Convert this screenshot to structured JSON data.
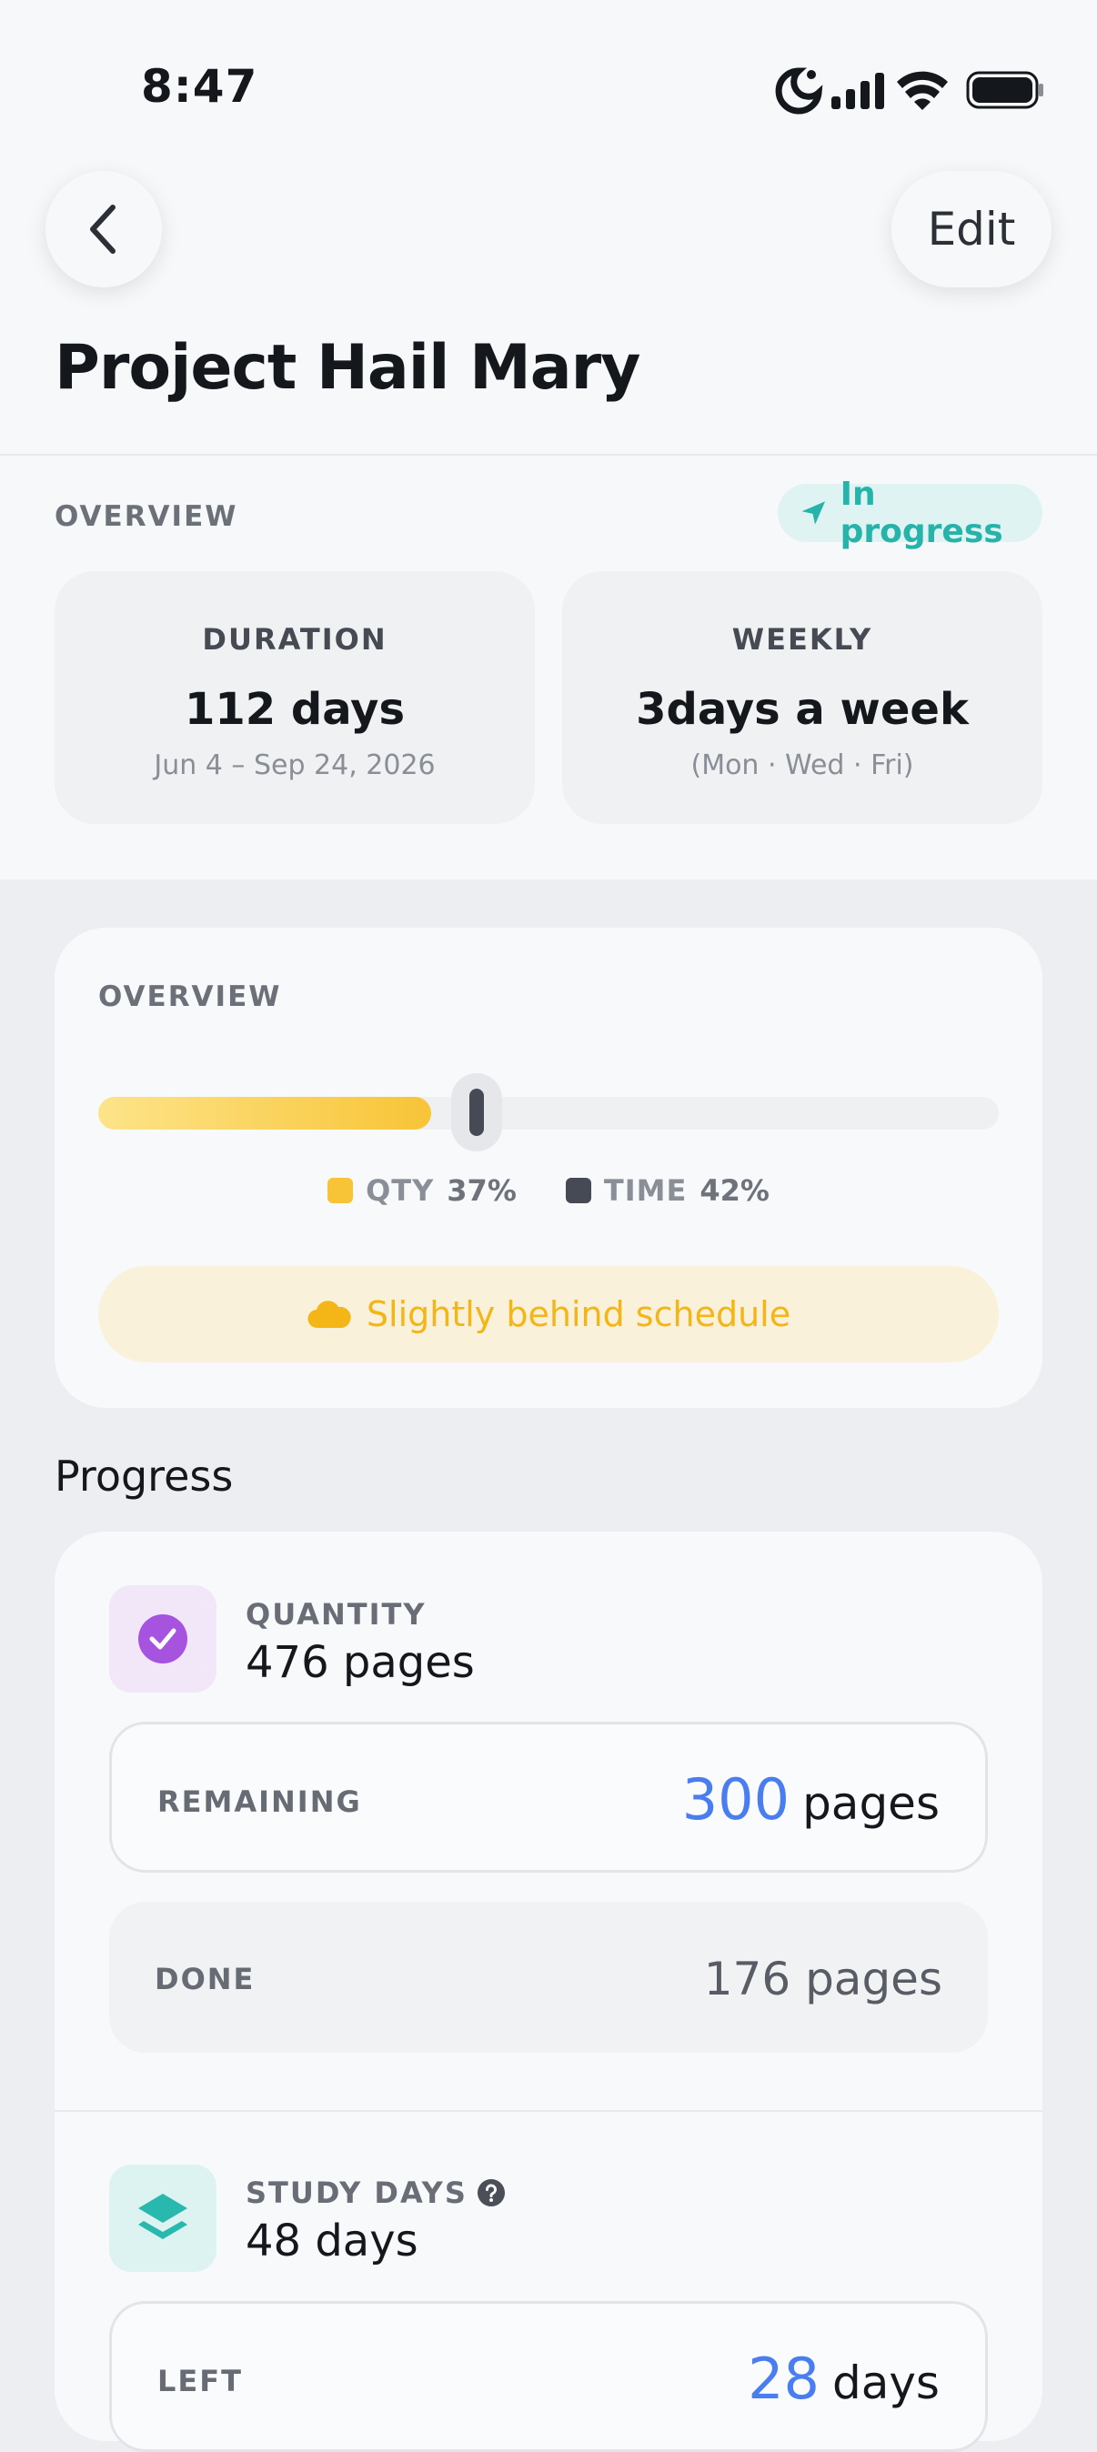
{
  "status_bar": {
    "time": "8:47"
  },
  "nav": {
    "back_icon": "chevron-left-icon",
    "edit_label": "Edit"
  },
  "title": "Project Hail Mary",
  "overview": {
    "label": "OVERVIEW",
    "badge": "In progress",
    "badge_icon": "navigation-arrow-icon",
    "badge_color": "#25b3aa",
    "duration": {
      "label": "DURATION",
      "value": "112 days",
      "sub": "Jun 4 – Sep 24, 2026"
    },
    "weekly": {
      "label": "WEEKLY",
      "value": "3days a week",
      "sub": "(Mon · Wed · Fri)"
    }
  },
  "overview_card": {
    "label": "OVERVIEW",
    "qty_fraction": 0.37,
    "time_fraction": 0.42,
    "legend": {
      "qty_label": "QTY",
      "qty_pct": "37%",
      "qty_color": "#f8c437",
      "time_label": "TIME",
      "time_pct": "42%",
      "time_color": "#454a54"
    },
    "alert": {
      "icon": "cloud-icon",
      "text": "Slightly behind schedule",
      "color": "#f4b517"
    }
  },
  "progress": {
    "heading": "Progress",
    "quantity": {
      "icon": "check-circle-icon",
      "label": "QUANTITY",
      "value": "476 pages",
      "remaining_label": "REMAINING",
      "remaining_num": "300",
      "remaining_unit": "pages",
      "done_label": "DONE",
      "done_value": "176 pages"
    },
    "study_days": {
      "icon": "layers-icon",
      "label": "STUDY DAYS",
      "help_icon": "question-circle-icon",
      "value": "48 days",
      "left_label": "LEFT",
      "left_num": "28",
      "left_unit": "days"
    }
  }
}
